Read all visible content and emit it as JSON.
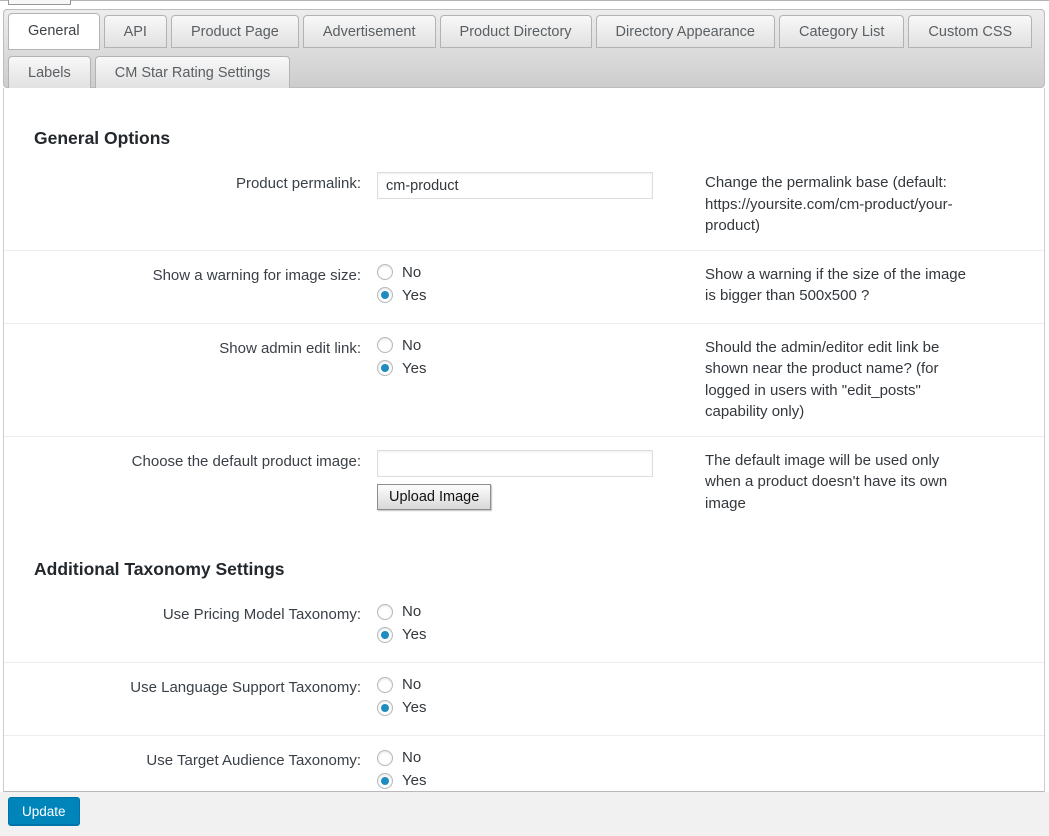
{
  "colors": {
    "accent_blue": "#0085ba",
    "radio_selected_blue": "#1e8cbe",
    "footer_background": "#f1f1f1",
    "tabbar_gradient_top": "#ededed",
    "tabbar_gradient_bottom": "#cdcdcd"
  },
  "tabs": [
    {
      "label": "General",
      "active": true
    },
    {
      "label": "API",
      "active": false
    },
    {
      "label": "Product Page",
      "active": false
    },
    {
      "label": "Advertisement",
      "active": false
    },
    {
      "label": "Product Directory",
      "active": false
    },
    {
      "label": "Directory Appearance",
      "active": false
    },
    {
      "label": "Category List",
      "active": false
    },
    {
      "label": "Custom CSS",
      "active": false
    },
    {
      "label": "Labels",
      "active": false
    },
    {
      "label": "CM Star Rating Settings",
      "active": false
    }
  ],
  "sections": [
    {
      "heading": "General Options",
      "rows": [
        {
          "label": "Product permalink:",
          "control": "text",
          "value": "cm-product",
          "description": "Change the permalink base (default: https://yoursite.com/cm-product/your-product)"
        },
        {
          "label": "Show a warning for image size:",
          "control": "radio",
          "options": [
            "No",
            "Yes"
          ],
          "selected": "Yes",
          "description": "Show a warning if the size of the image is bigger than 500x500 ?"
        },
        {
          "label": "Show admin edit link:",
          "control": "radio",
          "options": [
            "No",
            "Yes"
          ],
          "selected": "Yes",
          "description": "Should the admin/editor edit link be shown near the product name? (for logged in users with \"edit_posts\" capability only)"
        },
        {
          "label": "Choose the default product image:",
          "control": "text_with_button",
          "value": "",
          "button_label": "Upload Image",
          "description": "The default image will be used only when a product doesn't have its own image"
        }
      ]
    },
    {
      "heading": "Additional Taxonomy Settings",
      "rows": [
        {
          "label": "Use Pricing Model Taxonomy:",
          "control": "radio",
          "options": [
            "No",
            "Yes"
          ],
          "selected": "Yes",
          "description": ""
        },
        {
          "label": "Use Language Support Taxonomy:",
          "control": "radio",
          "options": [
            "No",
            "Yes"
          ],
          "selected": "Yes",
          "description": ""
        },
        {
          "label": "Use Target Audience Taxonomy:",
          "control": "radio",
          "options": [
            "No",
            "Yes"
          ],
          "selected": "Yes",
          "description": ""
        }
      ]
    }
  ],
  "footer": {
    "update_label": "Update"
  }
}
